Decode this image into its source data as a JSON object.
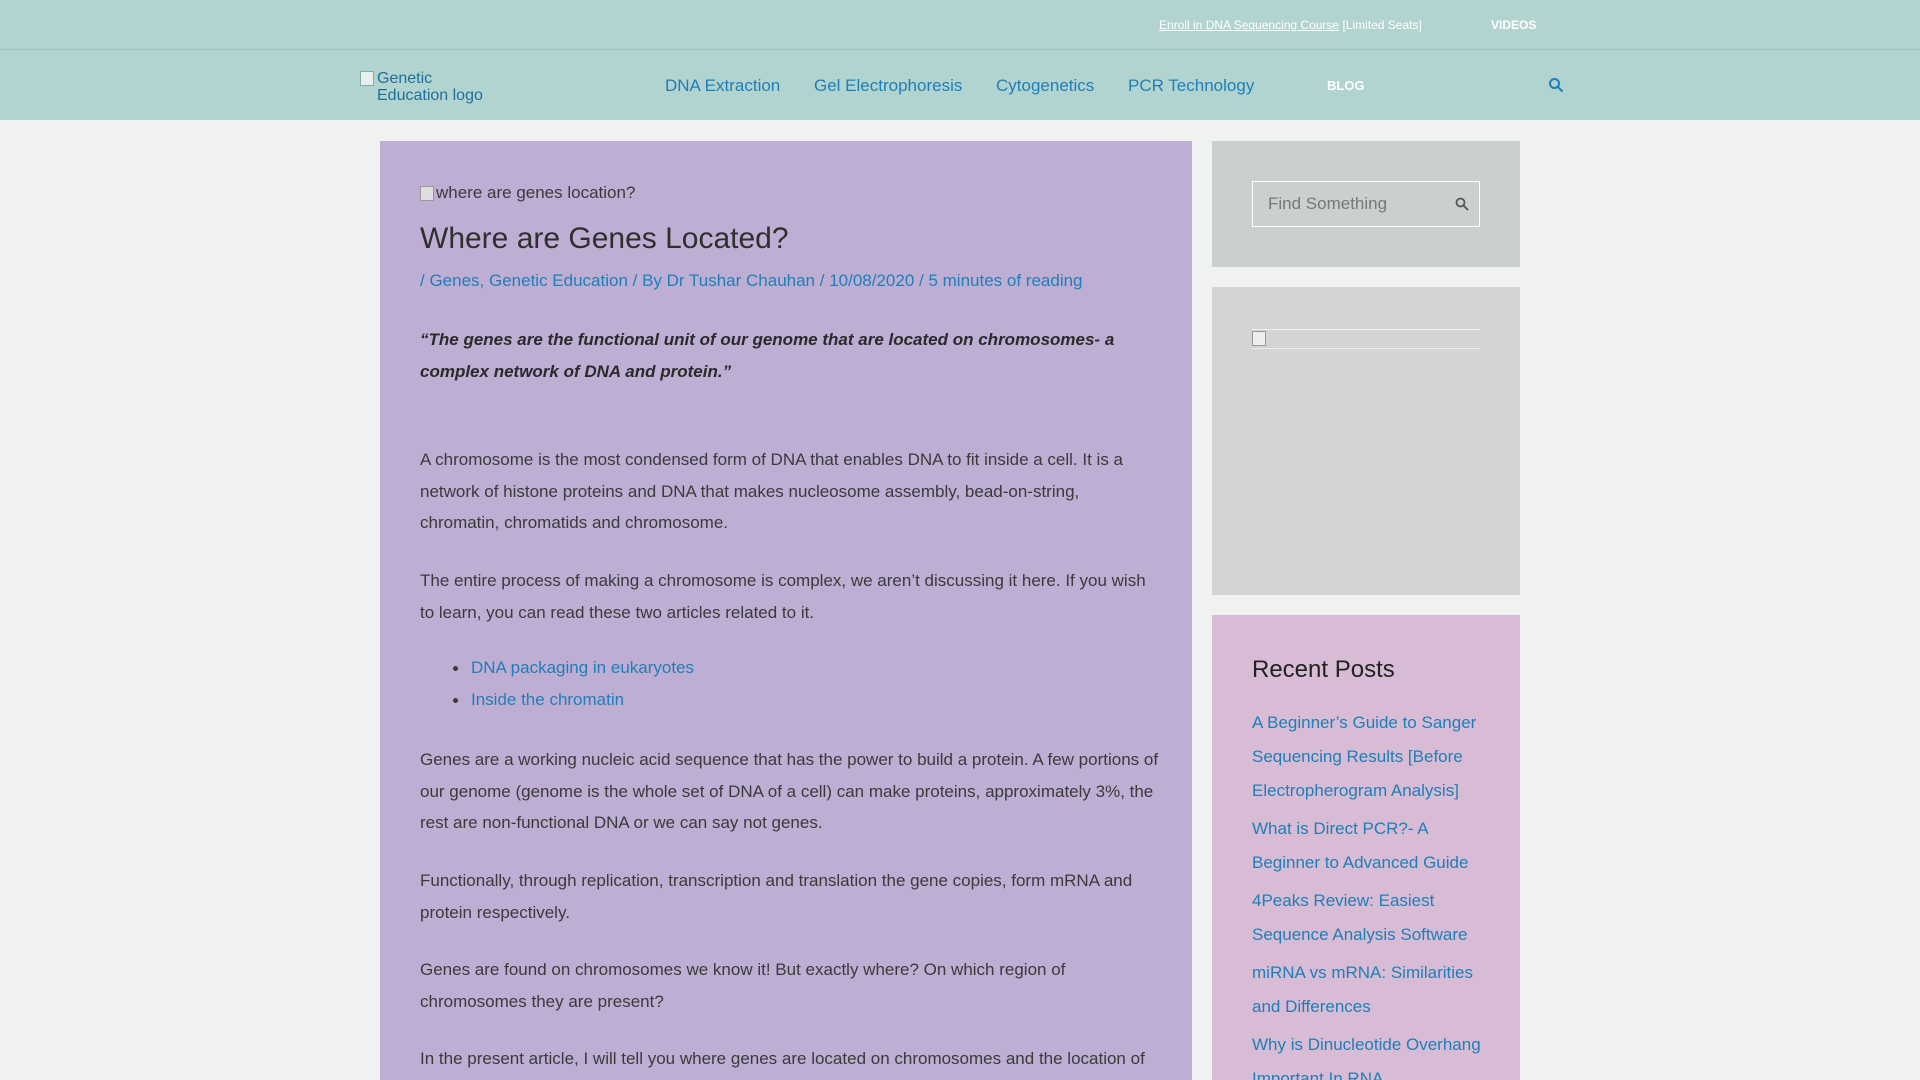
{
  "topbar": {
    "enroll_link": "Enroll in DNA Sequencing Course",
    "enroll_suffix": " [Limited Seats]",
    "videos": "VIDEOS"
  },
  "header": {
    "logo_alt": "Genetic Education logo",
    "nav": [
      "DNA Extraction",
      "Gel Electrophoresis",
      "Cytogenetics",
      "PCR Technology"
    ],
    "blog": "BLOG",
    "search_icon": "search-icon"
  },
  "article": {
    "featured_alt": "where are genes location?",
    "title": "Where are Genes Located?",
    "meta": {
      "sep1": "/ ",
      "cat1": "Genes",
      "comma": ", ",
      "cat2": "Genetic Education",
      "by": " / By ",
      "author": "Dr Tushar Chauhan",
      "sep2": " / ",
      "date": "10/08/2020",
      "sep3": " / ",
      "reading": "5 minutes of reading"
    },
    "quote": "“The genes are the functional unit of our genome that are located on chromosomes- a complex network of DNA and protein.”",
    "p1": "A chromosome is the most condensed form of DNA that enables DNA to fit inside a cell. It is a network of histone proteins and DNA that makes nucleosome assembly, bead-on-string, chromatin, chromatids and chromosome.",
    "p2": "The entire process of making a chromosome is complex, we aren’t discussing it here. If you wish to learn, you can read these two articles related to it.",
    "links": [
      "DNA packaging in eukaryotes",
      "Inside the chromatin"
    ],
    "p3": "Genes are a working nucleic acid sequence that has the power to build a protein. A few portions of our genome (genome is the whole set of DNA of a cell) can make proteins, approximately 3%, the rest are non-functional DNA or we can say not genes.",
    "p4": "Functionally, through replication, transcription and translation the gene copies, form mRNA and protein respectively.",
    "p5": "Genes are found on chromosomes we know it! But exactly where? On which region of chromosomes they are present?",
    "p6": "In the present article, I will tell you where genes are located on chromosomes and the location of"
  },
  "sidebar": {
    "search_placeholder": "Find Something",
    "recent_title": "Recent Posts",
    "recent_posts": [
      "A Beginner’s Guide to Sanger Sequencing Results [Before Electropherogram Analysis]",
      "What is Direct PCR?- A Beginner to Advanced Guide",
      "4Peaks Review: Easiest Sequence Analysis Software",
      "miRNA vs mRNA: Similarities and Differences",
      "Why is Dinucleotide Overhang Important In RNA"
    ]
  }
}
